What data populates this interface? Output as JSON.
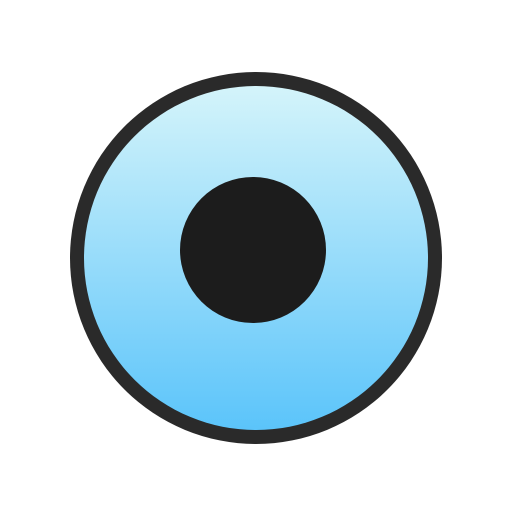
{
  "icon": {
    "name": "radio-button-selected-icon",
    "colors": {
      "background": "#ffffff",
      "ring": "#2a2a2a",
      "fill_top": "#d4f4fa",
      "fill_bottom": "#5bc4fa",
      "dot": "#1c1c1c"
    }
  }
}
